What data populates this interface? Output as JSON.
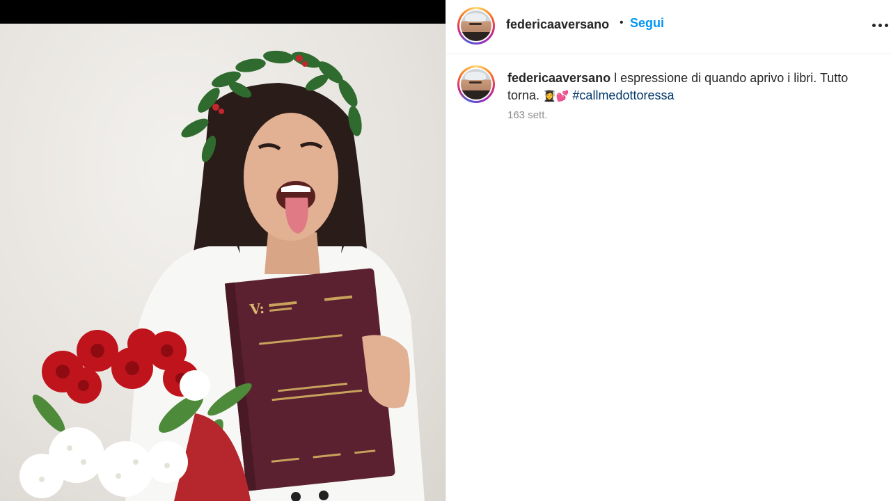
{
  "post": {
    "image_description_icon": "photo",
    "author": {
      "username": "federicaaversano",
      "separator": "•",
      "follow_label": "Segui"
    },
    "more_icon": "more-horizontal-icon",
    "caption": {
      "username": "federicaaversano",
      "text": "l espressione di quando aprivo i libri. Tutto torna.",
      "emoji": "👩‍🎓💕",
      "hashtag": "#callmedottoressa"
    },
    "time_ago": "163 sett."
  },
  "colors": {
    "follow_blue": "#0095f6",
    "hashtag_blue": "#00376b",
    "secondary_text": "#8e8e8e",
    "book_cover": "#5b2130",
    "roses": "#c0141c"
  }
}
